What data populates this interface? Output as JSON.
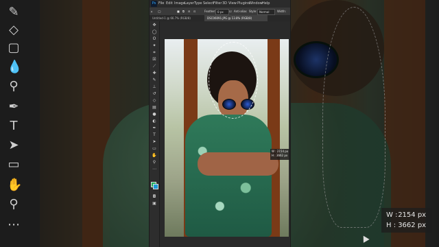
{
  "app": {
    "logo": "Ps",
    "menu": [
      "File",
      "Edit",
      "Image",
      "Layer",
      "Type",
      "Select",
      "Filter",
      "3D",
      "View",
      "Plugins",
      "Window",
      "Help"
    ]
  },
  "options": {
    "feather_label": "Feather:",
    "feather_value": "0 px",
    "antialias_label": "Anti-alias",
    "style_label": "Style:",
    "style_value": "Normal",
    "width_label": "Width:"
  },
  "tabs": [
    {
      "label": "Untitled-1 @ 66.7% (RGB/8)"
    },
    {
      "label": "DSC06091.JPG @ 13.8% (RGB/8)"
    }
  ],
  "selection_size_small": {
    "w": "W : 2154 px",
    "h": "H : 3662 px"
  },
  "selection_size_big": {
    "w_label": "W :",
    "w_value": "2154 px",
    "h_label": "H :",
    "h_value": "3662 px"
  },
  "icons": {
    "left_tools": [
      "brush-icon",
      "eraser-icon",
      "gradient-icon",
      "blur-icon",
      "dodge-icon",
      "pen-icon",
      "type-icon",
      "path-select-icon",
      "rectangle-icon",
      "hand-icon",
      "zoom-icon",
      "more-icon"
    ],
    "ps_tools": [
      "move-icon",
      "marquee-icon",
      "lasso-icon",
      "quick-select-icon",
      "crop-icon",
      "frame-icon",
      "eyedropper-icon",
      "spot-heal-icon",
      "brush-icon",
      "stamp-icon",
      "history-brush-icon",
      "eraser-icon",
      "gradient-icon",
      "blur-icon",
      "dodge-icon",
      "pen-icon",
      "type-icon",
      "path-select-icon",
      "rectangle-icon",
      "hand-icon",
      "zoom-icon",
      "more-icon"
    ]
  },
  "colors": {
    "foreground": "#1fae5a",
    "background": "#1e9ad6"
  }
}
